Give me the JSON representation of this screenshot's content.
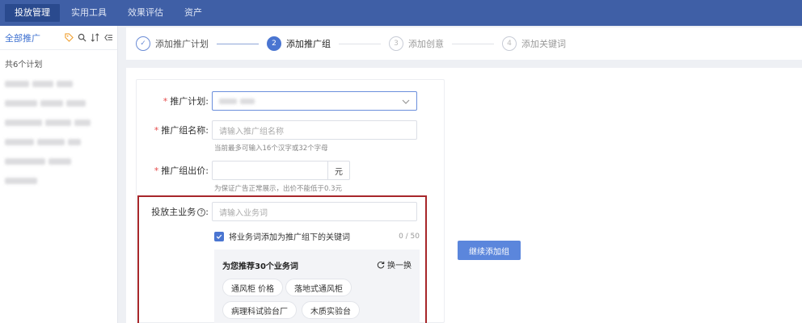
{
  "nav": {
    "items": [
      {
        "label": "投放管理",
        "active": true
      },
      {
        "label": "实用工具",
        "active": false
      },
      {
        "label": "效果评估",
        "active": false
      },
      {
        "label": "资产",
        "active": false
      }
    ]
  },
  "sidebar": {
    "all_label": "全部推广",
    "icons": [
      "tag-icon",
      "search-icon",
      "sort-icon",
      "collapse-icon"
    ],
    "count_label": "共6个计划"
  },
  "stepper": {
    "steps": [
      {
        "number": "✓",
        "label": "添加推广计划",
        "state": "done"
      },
      {
        "number": "2",
        "label": "添加推广组",
        "state": "active"
      },
      {
        "number": "3",
        "label": "添加创意",
        "state": "todo"
      },
      {
        "number": "4",
        "label": "添加关键词",
        "state": "todo"
      }
    ]
  },
  "form": {
    "plan_label": "推广计划:",
    "group_name_label": "推广组名称:",
    "group_name_placeholder": "请输入推广组名称",
    "group_name_hint": "当前最多可输入16个汉字或32个字母",
    "bid_label": "推广组出价:",
    "bid_unit": "元",
    "bid_hint": "为保证广告正常展示，出价不能低于0.3元",
    "business_label": "投放主业务",
    "business_placeholder": "请输入业务词",
    "checkbox_label": "将业务词添加为推广组下的关键词",
    "checkbox_count": "0 / 50",
    "recommend_title": "为您推荐30个业务词",
    "refresh_label": "换一换",
    "tags": [
      "通风柜 价格",
      "落地式通风柜",
      "病理科试验台厂",
      "木质实验台"
    ]
  },
  "actions": {
    "continue_label": "继续添加组"
  },
  "colors": {
    "nav_bg": "#3f5fa6",
    "primary": "#4a75d1",
    "highlight_border": "#a7262a",
    "required": "#e54a4a"
  }
}
